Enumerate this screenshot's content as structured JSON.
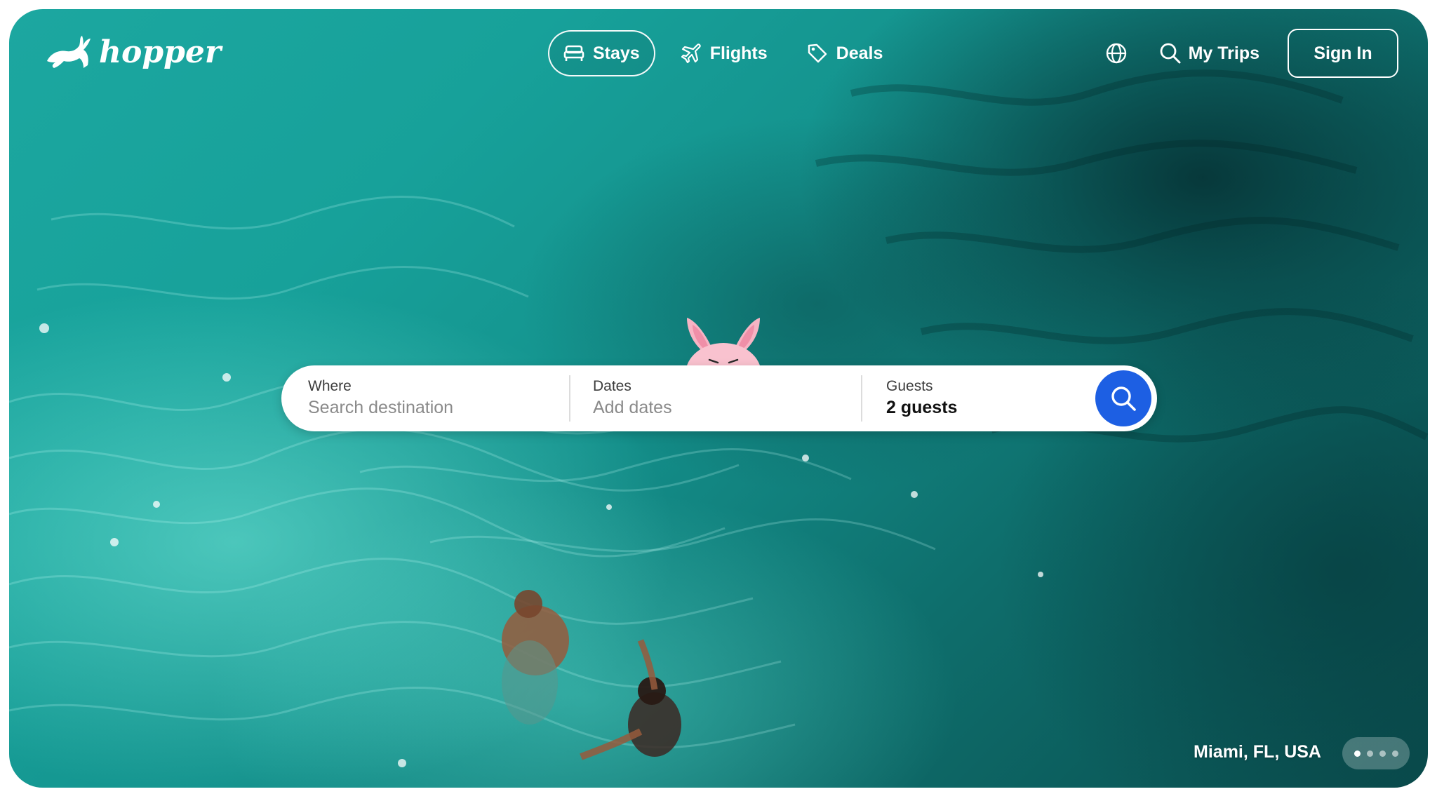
{
  "brand": {
    "name": "hopper",
    "logo_icon": "bunny-leaping-icon"
  },
  "nav": {
    "items": [
      {
        "label": "Stays",
        "icon": "bed-icon",
        "active": true
      },
      {
        "label": "Flights",
        "icon": "airplane-icon",
        "active": false
      },
      {
        "label": "Deals",
        "icon": "tag-icon",
        "active": false
      }
    ]
  },
  "header_right": {
    "language_icon": "globe-icon",
    "my_trips_label": "My Trips",
    "my_trips_icon": "search-icon",
    "sign_in_label": "Sign In"
  },
  "search": {
    "where_label": "Where",
    "where_placeholder": "Search destination",
    "dates_label": "Dates",
    "dates_placeholder": "Add dates",
    "guests_label": "Guests",
    "guests_value": "2 guests",
    "button_icon": "search-icon",
    "mascot_icon": "bunny-mascot-icon"
  },
  "hero": {
    "location": "Miami, FL, USA",
    "carousel_count": 4,
    "carousel_active": 1
  },
  "colors": {
    "accent": "#1d5fe3",
    "water_light": "#1ca7a0",
    "water_dark": "#0a4c4d",
    "mascot_pink": "#f6b4c4"
  }
}
